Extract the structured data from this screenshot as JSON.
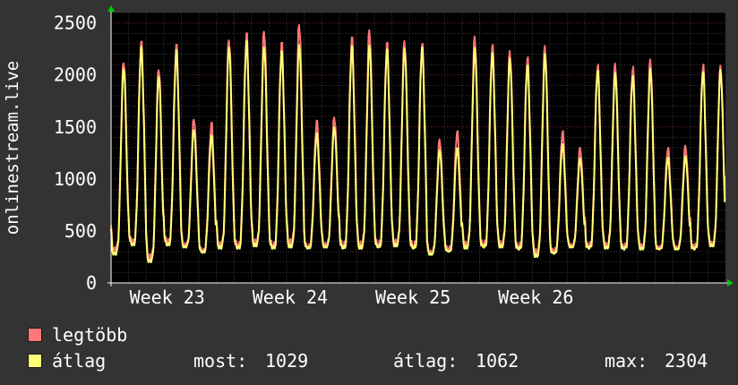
{
  "chart_data": {
    "type": "line",
    "ylabel": "onlinestream.live",
    "ylim": [
      0,
      2600
    ],
    "yticks": [
      0,
      500,
      1000,
      1500,
      2000,
      2500
    ],
    "xticks": [
      "Week 23",
      "Week 24",
      "Week 25",
      "Week 26"
    ],
    "grid": true,
    "days": 35,
    "series": [
      {
        "name": "legtöbb",
        "color": "#ff7777",
        "daily_peaks": [
          2150,
          2320,
          2080,
          2290,
          1590,
          1540,
          2360,
          2400,
          2440,
          2310,
          2500,
          1560,
          1600,
          2360,
          2440,
          2310,
          2330,
          2300,
          1380,
          1460,
          2370,
          2290,
          2230,
          2170,
          2280,
          1460,
          1300,
          2100,
          2110,
          2080,
          2150,
          1300,
          1320,
          2100,
          2090
        ],
        "daily_lows": [
          300,
          380,
          230,
          380,
          350,
          300,
          340,
          340,
          360,
          340,
          360,
          340,
          350,
          340,
          340,
          350,
          360,
          340,
          280,
          320,
          340,
          350,
          350,
          330,
          270,
          300,
          350,
          340,
          340,
          330,
          330,
          330,
          330,
          330,
          360
        ]
      },
      {
        "name": "átlag",
        "color": "#ffff77",
        "daily_peaks": [
          2080,
          2270,
          2000,
          2240,
          1480,
          1420,
          2280,
          2330,
          2280,
          2230,
          2300,
          1440,
          1500,
          2280,
          2290,
          2250,
          2260,
          2270,
          1280,
          1300,
          2260,
          2220,
          2160,
          2100,
          2200,
          1340,
          1200,
          2050,
          2020,
          2000,
          2060,
          1210,
          1220,
          2040,
          2050
        ],
        "daily_lows": [
          270,
          360,
          200,
          360,
          340,
          290,
          330,
          330,
          350,
          330,
          340,
          330,
          340,
          330,
          330,
          340,
          350,
          330,
          270,
          300,
          330,
          340,
          340,
          320,
          250,
          280,
          340,
          330,
          330,
          320,
          320,
          320,
          320,
          320,
          350
        ],
        "current": 1029
      }
    ],
    "stats": {
      "most_label": "most:",
      "most_value": "1029",
      "atlag_label": "átlag:",
      "atlag_value": "1062",
      "max_label": "max:",
      "max_value": "2304"
    }
  }
}
